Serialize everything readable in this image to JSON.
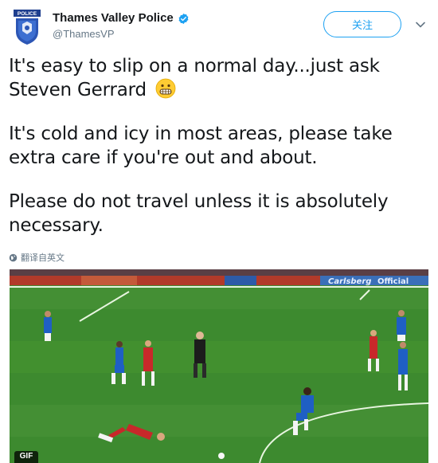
{
  "author": {
    "display_name": "Thames Valley Police",
    "handle": "@ThamesVP",
    "badge_text": "POLICE",
    "verified": true
  },
  "follow_button": {
    "label": "关注"
  },
  "tweet": {
    "line1_part1": "It's easy to slip on a normal day...just ask",
    "line1_part2": "Steven Gerrard",
    "paragraph2": "It's cold and icy in most areas, please take extra care if you're out and about.",
    "paragraph3": "Please do not travel unless it is absolutely necessary."
  },
  "translate": {
    "label": "翻译自英文"
  },
  "media": {
    "type": "gif",
    "badge": "GIF",
    "board_text_1": "Carlsberg",
    "board_text_2": "Official"
  },
  "colors": {
    "accent": "#1da1f2",
    "secondary_text": "#657786",
    "pitch": "#3d8a2f"
  },
  "icons": [
    "police-crest-icon",
    "verified-badge-icon",
    "chevron-down-icon",
    "grimacing-emoji-icon",
    "globe-icon"
  ]
}
